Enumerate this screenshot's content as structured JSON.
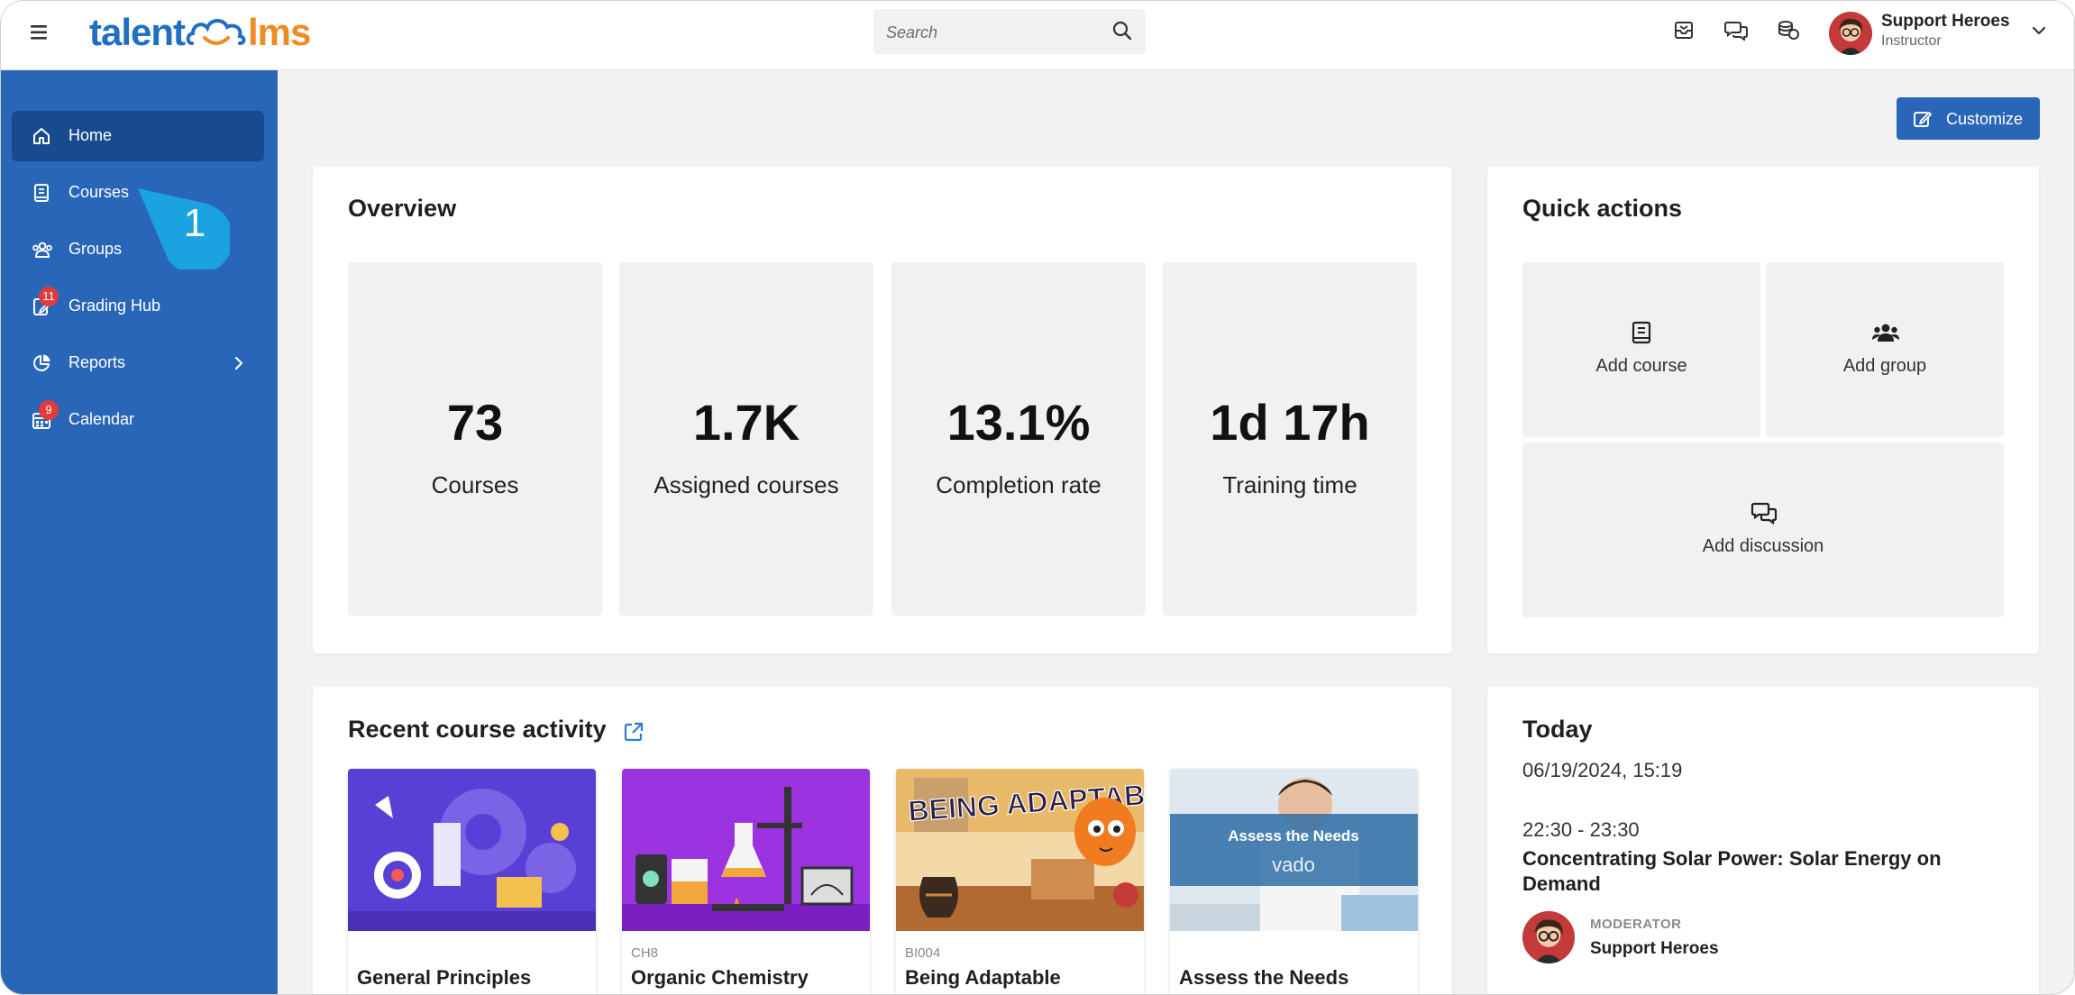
{
  "header": {
    "logo_left": "talent",
    "logo_right": "lms",
    "search_placeholder": "Search",
    "user_name": "Support Heroes",
    "user_role": "Instructor",
    "icons": [
      "menu-icon",
      "search-icon",
      "inbox-icon",
      "messages-icon",
      "coins-icon",
      "chevron-down-icon"
    ]
  },
  "sidebar": {
    "items": [
      {
        "label": "Home",
        "icon": "home-icon",
        "active": true
      },
      {
        "label": "Courses",
        "icon": "book-icon"
      },
      {
        "label": "Groups",
        "icon": "users-icon"
      },
      {
        "label": "Grading Hub",
        "icon": "grading-icon",
        "badge": "11"
      },
      {
        "label": "Reports",
        "icon": "pie-chart-icon"
      },
      {
        "label": "Calendar",
        "icon": "calendar-icon",
        "badge": "9"
      }
    ],
    "callout": "1"
  },
  "main": {
    "customize_label": "Customize",
    "overview": {
      "title": "Overview",
      "stats": [
        {
          "value": "73",
          "label": "Courses"
        },
        {
          "value": "1.7K",
          "label": "Assigned courses"
        },
        {
          "value": "13.1%",
          "label": "Completion rate"
        },
        {
          "value": "1d 17h",
          "label": "Training time"
        }
      ]
    },
    "quick_actions": {
      "title": "Quick actions",
      "items": [
        {
          "label": "Add course",
          "icon": "book-icon"
        },
        {
          "label": "Add group",
          "icon": "users-icon"
        },
        {
          "label": "Add discussion",
          "icon": "discussion-icon"
        }
      ]
    },
    "recent": {
      "title": "Recent course activity",
      "courses": [
        {
          "code": "",
          "name": "General Principles"
        },
        {
          "code": "CH8",
          "name": "Organic Chemistry"
        },
        {
          "code": "BI004",
          "name": "Being Adaptable",
          "image_text": "BEING ADAPTABLE"
        },
        {
          "code": "",
          "name": "Assess the Needs",
          "image_text": "Assess the Needs",
          "image_subtext": "vado"
        }
      ]
    },
    "today": {
      "title": "Today",
      "date": "06/19/2024, 15:19",
      "time": "22:30 - 23:30",
      "event": "Concentrating Solar Power: Solar Energy on Demand",
      "moderator_label": "MODERATOR",
      "moderator_name": "Support Heroes"
    }
  },
  "colors": {
    "sidebar": "#2a66b8",
    "sidebar_active": "#174a8f",
    "brand_blue": "#1f6fc2",
    "brand_orange": "#f08a24",
    "badge": "#e23b3b",
    "callout": "#1aa3e0"
  }
}
